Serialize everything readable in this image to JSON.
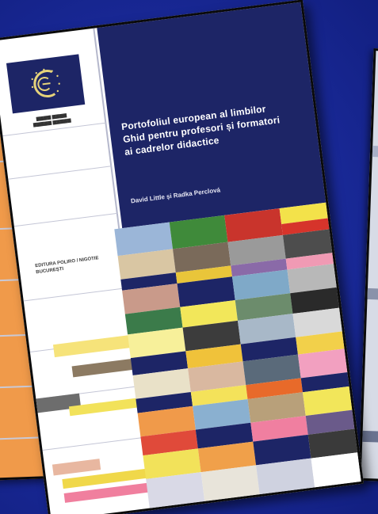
{
  "cover": {
    "title_line1": "Portofoliul european al limbilor",
    "title_line2": "Ghid pentru profesori și formatori",
    "title_line3": "ai cadrelor didactice",
    "authors": "David Little și Radka Perclová",
    "publisher": "EDITURA POLIRO / NIGOTIE BUCUREȘTI"
  },
  "colors": {
    "background": "#1a2a9a",
    "cover_band": "#1d2566",
    "left_booklet": "#f09a4a"
  },
  "icons": [
    "council-of-europe-logo-icon"
  ]
}
